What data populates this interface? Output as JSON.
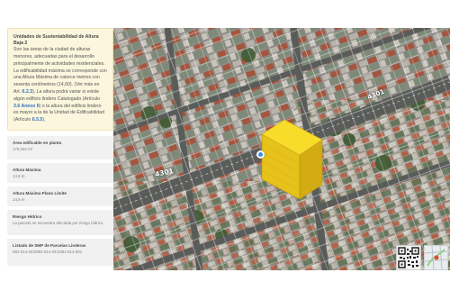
{
  "panel": {
    "section_title": "Unidades de Sustentabilidad de Altura Baja 2",
    "description_parts": [
      "Son las áreas de la ciudad de alturas menores, adecuadas para el desarrollo principalmente de actividades residenciales. La edificabilidad máxima se corresponde con una Altura Máxima de catorce metros con sesenta centímetros (14,60). (Ver más en Art. ",
      "6.2.3",
      "). La altura podrá variar si existe algún edificio lindero Catalogado (Artículo ",
      "3.6 Anexo II",
      ") o la altura del edificio lindero es mayor a la de la Unidad de Edificabilidad (Artículo ",
      "6.5.5",
      ")."
    ],
    "properties": [
      {
        "label": "Área edificable en planta",
        "value": "170,342 m²"
      },
      {
        "label": "Altura Máxima",
        "value": "14,6 m"
      },
      {
        "label": "Altura Máxima Plano Límite",
        "value": "14,6 m"
      },
      {
        "label": "Riesgo Hídrico",
        "value": "La parcela se encuentra afectada por riesgo hídrico."
      },
      {
        "label": "Listado de SMP de Parcelas Linderas",
        "value": "081-014-042/081-014-041/081-014-001"
      }
    ]
  },
  "map": {
    "street_labels": [
      "4301",
      "4301"
    ],
    "colors": {
      "building_top": "#f7dc2a",
      "building_left": "#e6c21a",
      "building_right": "#d2ac12",
      "parcel_outline": "#ffffff",
      "location_pin": "#3b8ee0",
      "link": "#2e6fc7",
      "info_box": "#fbf6dd"
    }
  }
}
